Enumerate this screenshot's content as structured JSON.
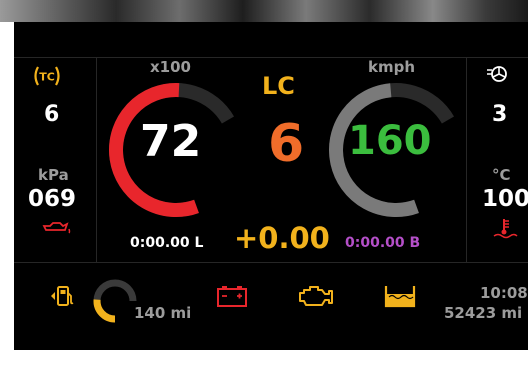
{
  "left_panel": {
    "tc_label": "TC",
    "tc_value": "6",
    "pressure_unit": "kPa",
    "pressure_value": "069"
  },
  "rpm_gauge": {
    "unit": "x100",
    "value": "72",
    "fill_fraction": 0.78,
    "color": "#e8262c"
  },
  "launch_control": {
    "label": "LC",
    "value": "6"
  },
  "speed_gauge": {
    "unit": "kmph",
    "value": "160",
    "fill_fraction": 0.75,
    "color": "#7a7a7a"
  },
  "timers": {
    "last_lap": "0:00.00 L",
    "delta": "+0.00",
    "best_lap": "0:00.00 B"
  },
  "right_panel": {
    "value_top": "3",
    "temp_unit": "°C",
    "temp_value": "100"
  },
  "bottom_bar": {
    "fuel_range": "140 mi",
    "fuel_fraction": 0.35,
    "clock": "10:08",
    "odometer": "52423 mi"
  },
  "colors": {
    "accent_gold": "#f2b21c",
    "warning_red": "#e8262c",
    "delta_yellow": "#f2b21c",
    "lc_orange": "#f06d2a",
    "speed_green": "#3bbd3e",
    "best_purple": "#b44fc8"
  }
}
